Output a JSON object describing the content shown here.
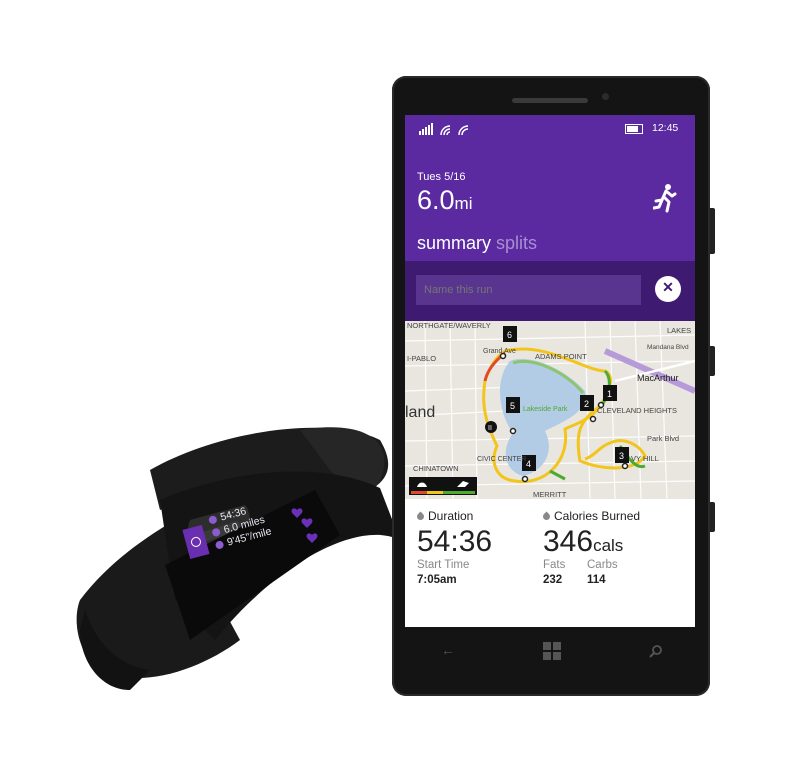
{
  "band": {
    "duration": "54:36",
    "distance": "6.0 miles",
    "pace": "9'45\"/mile"
  },
  "status_bar": {
    "time": "12:45"
  },
  "run": {
    "date": "Tues 5/16",
    "distance_value": "6.0",
    "distance_unit": "mi"
  },
  "tabs": [
    {
      "label": "summary",
      "active": true
    },
    {
      "label": "splits",
      "active": false
    }
  ],
  "name_input": {
    "placeholder": "Name this run",
    "value": ""
  },
  "map": {
    "labels": [
      "NORTHGATE/WAVERLY",
      "ADAMS POINT",
      "Grand Ave",
      "LAKES",
      "Mandana Blvd",
      "MacArthur",
      "I-PABLO",
      "Lakeside Park",
      "CLEVELAND HEIGHTS",
      "land",
      "Park Blvd",
      "CHINATOWN",
      "CIVIC CENTER",
      "VY HILL",
      "MERRITT"
    ],
    "markers": [
      "1",
      "2",
      "3",
      "4",
      "5",
      "6"
    ]
  },
  "summary": {
    "duration_label": "Duration",
    "duration_value": "54:36",
    "start_time_label": "Start Time",
    "start_time_value": "7:05am",
    "calories_label": "Calories Burned",
    "calories_value": "346",
    "calories_unit": "cals",
    "fats_label": "Fats",
    "fats_value": "232",
    "carbs_label": "Carbs",
    "carbs_value": "114"
  },
  "colors": {
    "accent": "#5b2aa1",
    "accent_dark": "#3e1b71",
    "route_yellow": "#f2c51d",
    "route_green": "#4caa2e",
    "lake": "#b3cce6"
  },
  "icons": [
    "signal-icon",
    "wifi-icon",
    "bluetooth-icon",
    "battery-icon",
    "runner-icon",
    "close-icon",
    "back-icon",
    "windows-icon",
    "search-icon",
    "fire-icon",
    "heart-icon"
  ]
}
